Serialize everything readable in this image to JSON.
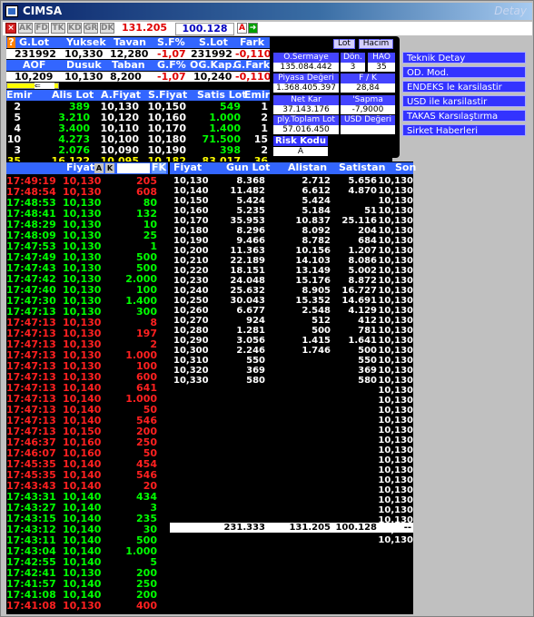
{
  "window": {
    "title": "CIMSA",
    "title_right": "Detay"
  },
  "toolbar": {
    "buttons": [
      "AK",
      "FD",
      "TK",
      "KD",
      "GR",
      "DK"
    ],
    "value1": "131.205",
    "value2": "100.128",
    "a_label": "A"
  },
  "summary": {
    "h1": [
      "G.Lot",
      "Yuksek",
      "Tavan",
      "S.F%",
      "S.Lot",
      "Fark"
    ],
    "v1": [
      "231992",
      "10,330",
      "12,280",
      "-1,07",
      "231992",
      "-0,110"
    ],
    "h2": [
      "AOF",
      "Dusuk",
      "Taban",
      "G.F%",
      "OG.Kap.",
      "G.Fark"
    ],
    "v2": [
      "10,209",
      "10,130",
      "8,200",
      "-1,07",
      "10,240",
      "-0,110"
    ]
  },
  "depth_header": [
    "Emir",
    "Alis Lot",
    "A.Fiyat",
    "S.Fiyat",
    "Satis Lot",
    "Emir"
  ],
  "depth": [
    [
      "2",
      "389",
      "10,130",
      "10,150",
      "549",
      "1"
    ],
    [
      "5",
      "3.210",
      "10,120",
      "10,160",
      "1.000",
      "2"
    ],
    [
      "4",
      "3.400",
      "10,110",
      "10,170",
      "1.400",
      "1"
    ],
    [
      "10",
      "4.273",
      "10,100",
      "10,180",
      "71.500",
      "15"
    ],
    [
      "3",
      "2.076",
      "10,090",
      "10,190",
      "398",
      "2"
    ],
    [
      "35",
      "16.122",
      "10,095",
      "10,182",
      "83.017",
      "36"
    ]
  ],
  "info_panel": {
    "lot_btn": "Lot",
    "hacim_btn": "Hacim",
    "o_sermaye": "O.Sermaye",
    "o_sermaye_val": "135.084.442",
    "don": "Dön.",
    "don_val": "3",
    "hao": "HAO",
    "hao_val": "35",
    "piyasa": "Piyasa Değeri",
    "piyasa_val": "1.368.405.397",
    "fk": "F / K",
    "fk_val": "28,84",
    "net_kar": "Net Kar",
    "net_kar_val": "37.143.176",
    "sapma": "'Sapma",
    "sapma_val": "-7,9000",
    "ply_lot": "ply.Toplam Lot",
    "ply_lot_val": "57.016.450",
    "usd": "USD Değeri",
    "risk": "Risk Kodu",
    "risk_val": "A"
  },
  "side_menu": [
    "Teknik Detay",
    "OD. Mod.",
    "ENDEKS le karsilastir",
    "USD ile karsilastir",
    "TAKAS Karsılaştırma",
    "Sirket Haberleri"
  ],
  "ticks_header": {
    "fiyat": "Fiyat",
    "fk": "FK"
  },
  "ticks": [
    [
      "17:49:19",
      "10,130",
      "205",
      "r"
    ],
    [
      "17:48:54",
      "10,130",
      "608",
      "r"
    ],
    [
      "17:48:53",
      "10,130",
      "80",
      "g"
    ],
    [
      "17:48:41",
      "10,130",
      "132",
      "g"
    ],
    [
      "17:48:29",
      "10,130",
      "10",
      "g"
    ],
    [
      "17:48:09",
      "10,130",
      "25",
      "g"
    ],
    [
      "17:47:53",
      "10,130",
      "1",
      "g"
    ],
    [
      "17:47:49",
      "10,130",
      "500",
      "g"
    ],
    [
      "17:47:43",
      "10,130",
      "500",
      "g"
    ],
    [
      "17:47:42",
      "10,130",
      "2.000",
      "g"
    ],
    [
      "17:47:40",
      "10,130",
      "100",
      "g"
    ],
    [
      "17:47:30",
      "10,130",
      "1.400",
      "g"
    ],
    [
      "17:47:13",
      "10,130",
      "300",
      "g"
    ],
    [
      "17:47:13",
      "10,130",
      "8",
      "r"
    ],
    [
      "17:47:13",
      "10,130",
      "197",
      "r"
    ],
    [
      "17:47:13",
      "10,130",
      "2",
      "r"
    ],
    [
      "17:47:13",
      "10,130",
      "1.000",
      "r"
    ],
    [
      "17:47:13",
      "10,130",
      "100",
      "r"
    ],
    [
      "17:47:13",
      "10,130",
      "600",
      "r"
    ],
    [
      "17:47:13",
      "10,140",
      "641",
      "r"
    ],
    [
      "17:47:13",
      "10,140",
      "1.000",
      "r"
    ],
    [
      "17:47:13",
      "10,140",
      "50",
      "r"
    ],
    [
      "17:47:13",
      "10,140",
      "546",
      "r"
    ],
    [
      "17:47:13",
      "10,150",
      "200",
      "r"
    ],
    [
      "17:46:37",
      "10,160",
      "250",
      "r"
    ],
    [
      "17:46:07",
      "10,160",
      "50",
      "r"
    ],
    [
      "17:45:35",
      "10,140",
      "454",
      "r"
    ],
    [
      "17:45:35",
      "10,140",
      "546",
      "r"
    ],
    [
      "17:43:43",
      "10,140",
      "20",
      "r"
    ],
    [
      "17:43:31",
      "10,140",
      "434",
      "g"
    ],
    [
      "17:43:27",
      "10,140",
      "3",
      "g"
    ],
    [
      "17:43:15",
      "10,140",
      "235",
      "g"
    ],
    [
      "17:43:12",
      "10,140",
      "30",
      "g"
    ],
    [
      "17:43:11",
      "10,140",
      "500",
      "g"
    ],
    [
      "17:43:04",
      "10,140",
      "1.000",
      "g"
    ],
    [
      "17:42:55",
      "10,140",
      "5",
      "g"
    ],
    [
      "17:42:41",
      "10,130",
      "200",
      "g"
    ],
    [
      "17:41:57",
      "10,140",
      "250",
      "g"
    ],
    [
      "17:41:08",
      "10,140",
      "200",
      "g"
    ],
    [
      "17:41:08",
      "10,130",
      "400",
      "r"
    ]
  ],
  "dist_header": [
    "Fiyat",
    "Gun Lot",
    "Alistan",
    "Satistan",
    "Son"
  ],
  "dist": [
    [
      "10,130",
      "8.368",
      "2.712",
      "5.656",
      "10,130"
    ],
    [
      "10,140",
      "11.482",
      "6.612",
      "4.870",
      "10,130"
    ],
    [
      "10,150",
      "5.424",
      "5.424",
      "",
      "10,130"
    ],
    [
      "10,160",
      "5.235",
      "5.184",
      "51",
      "10,130"
    ],
    [
      "10,170",
      "35.953",
      "10.837",
      "25.116",
      "10,130"
    ],
    [
      "10,180",
      "8.296",
      "8.092",
      "204",
      "10,130"
    ],
    [
      "10,190",
      "9.466",
      "8.782",
      "684",
      "10,130"
    ],
    [
      "10,200",
      "11.363",
      "10.156",
      "1.207",
      "10,130"
    ],
    [
      "10,210",
      "22.189",
      "14.103",
      "8.086",
      "10,130"
    ],
    [
      "10,220",
      "18.151",
      "13.149",
      "5.002",
      "10,130"
    ],
    [
      "10,230",
      "24.048",
      "15.176",
      "8.872",
      "10,130"
    ],
    [
      "10,240",
      "25.632",
      "8.905",
      "16.727",
      "10,130"
    ],
    [
      "10,250",
      "30.043",
      "15.352",
      "14.691",
      "10,130"
    ],
    [
      "10,260",
      "6.677",
      "2.548",
      "4.129",
      "10,130"
    ],
    [
      "10,270",
      "924",
      "512",
      "412",
      "10,130"
    ],
    [
      "10,280",
      "1.281",
      "500",
      "781",
      "10,130"
    ],
    [
      "10,290",
      "3.056",
      "1.415",
      "1.641",
      "10,130"
    ],
    [
      "10,300",
      "2.246",
      "1.746",
      "500",
      "10,130"
    ],
    [
      "10,310",
      "550",
      "",
      "550",
      "10,130"
    ],
    [
      "10,320",
      "369",
      "",
      "369",
      "10,130"
    ],
    [
      "10,330",
      "580",
      "",
      "580",
      "10,130"
    ]
  ],
  "son_extra": [
    "10,130",
    "10,130",
    "10,130",
    "10,130",
    "10,130",
    "10,130",
    "10,130",
    "10,130",
    "10,130",
    "10,130",
    "10,130",
    "10,130",
    "10,130",
    "10,130",
    "10,130",
    "10,130"
  ],
  "totals": {
    "gun": "231.333",
    "alis": "131.205",
    "satis": "100.128",
    "son": "--"
  }
}
